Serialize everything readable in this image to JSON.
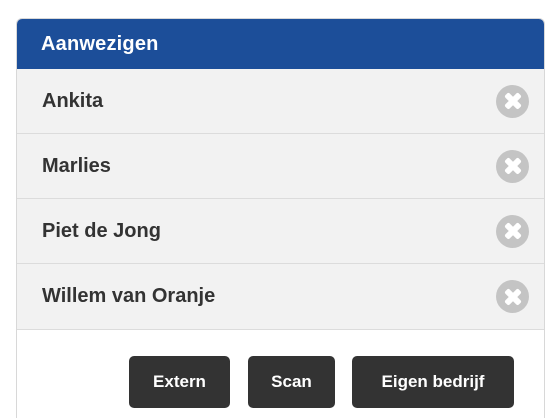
{
  "panel": {
    "title": "Aanwezigen"
  },
  "attendees": [
    {
      "name": "Ankita",
      "remove_icon": "close-circle-icon"
    },
    {
      "name": "Marlies",
      "remove_icon": "close-circle-icon"
    },
    {
      "name": "Piet de Jong",
      "remove_icon": "close-circle-icon"
    },
    {
      "name": "Willem van Oranje",
      "remove_icon": "close-circle-icon"
    }
  ],
  "actions": {
    "extern_label": "Extern",
    "scan_label": "Scan",
    "eigen_bedrijf_label": "Eigen bedrijf"
  },
  "colors": {
    "header_bg": "#1c4e99",
    "row_bg": "#f2f2f2",
    "button_bg": "#333333",
    "remove_icon": "#c4c4c4"
  }
}
